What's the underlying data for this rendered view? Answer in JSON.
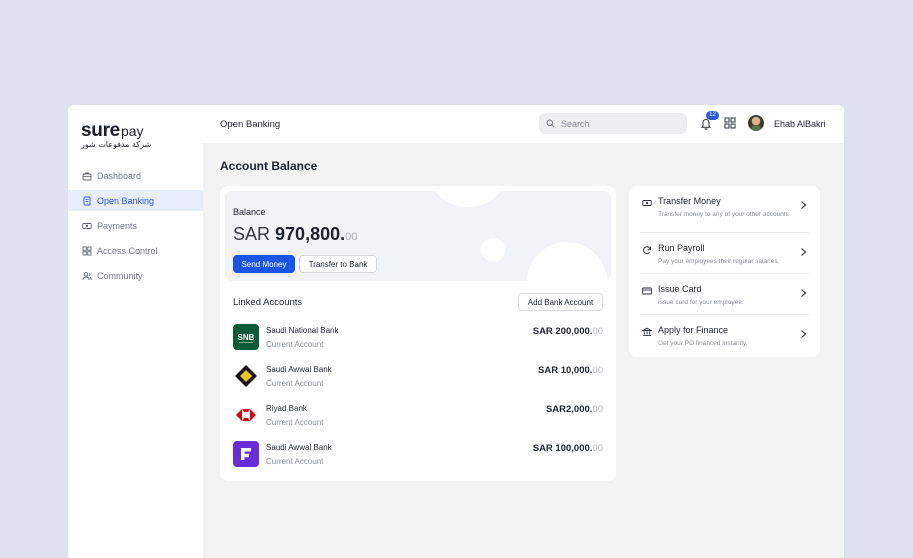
{
  "brand": {
    "name_main": "sure",
    "name_suffix": "pay",
    "name_arabic": "شركة مدفوعات شور"
  },
  "sidebar": {
    "items": [
      {
        "label": "Dashboard",
        "icon": "briefcase-icon",
        "active": false
      },
      {
        "label": "Open Banking",
        "icon": "document-icon",
        "active": true
      },
      {
        "label": "Payments",
        "icon": "cash-icon",
        "active": false
      },
      {
        "label": "Access Control",
        "icon": "grid-icon",
        "active": false
      },
      {
        "label": "Community",
        "icon": "users-icon",
        "active": false
      }
    ]
  },
  "header": {
    "title": "Open Banking",
    "search_placeholder": "Search",
    "notification_count": "12",
    "user_name": "Ehab AlBakri"
  },
  "main": {
    "page_title": "Account Balance",
    "balance": {
      "label": "Balance",
      "currency": "SAR",
      "amount_int": "970,800.",
      "amount_dec": "00"
    },
    "send_money_label": "Send Money",
    "transfer_bank_label": "Transfer to Bank",
    "linked_title": "Linked Accounts",
    "add_bank_label": "Add Bank Account",
    "accounts": [
      {
        "name": "Saudi National Bank",
        "type": "Current Account",
        "amount_int": "SAR 200,000.",
        "amount_dec": "00",
        "logo": "snb-logo"
      },
      {
        "name": "Saudi Awwal Bank",
        "type": "Current Account",
        "amount_int": "SAR 10,000.",
        "amount_dec": "00",
        "logo": "sab-logo"
      },
      {
        "name": "Riyad Bank",
        "type": "Current Account",
        "amount_int": "SAR2,000.",
        "amount_dec": "00",
        "logo": "riyad-logo"
      },
      {
        "name": "Saudi Awwal Bank",
        "type": "Current Account",
        "amount_int": "SAR 100,000.",
        "amount_dec": "00",
        "logo": "purple-f-logo"
      }
    ]
  },
  "actions": [
    {
      "title": "Transfer Money",
      "desc": "Transfer money to any of your other accounts",
      "icon": "cash-icon"
    },
    {
      "title": "Run Payroll",
      "desc": "Pay your employees their regular salaries.",
      "icon": "refresh-icon"
    },
    {
      "title": "Issue Card",
      "desc": "Issue card for your employee.",
      "icon": "card-icon"
    },
    {
      "title": "Apply for Finance",
      "desc": "Get your PO financed instantly.",
      "icon": "bank-icon"
    }
  ],
  "colors": {
    "accent": "#1b55e3",
    "active_nav_bg": "#e8edfb",
    "page_bg": "#dfe1ee"
  }
}
